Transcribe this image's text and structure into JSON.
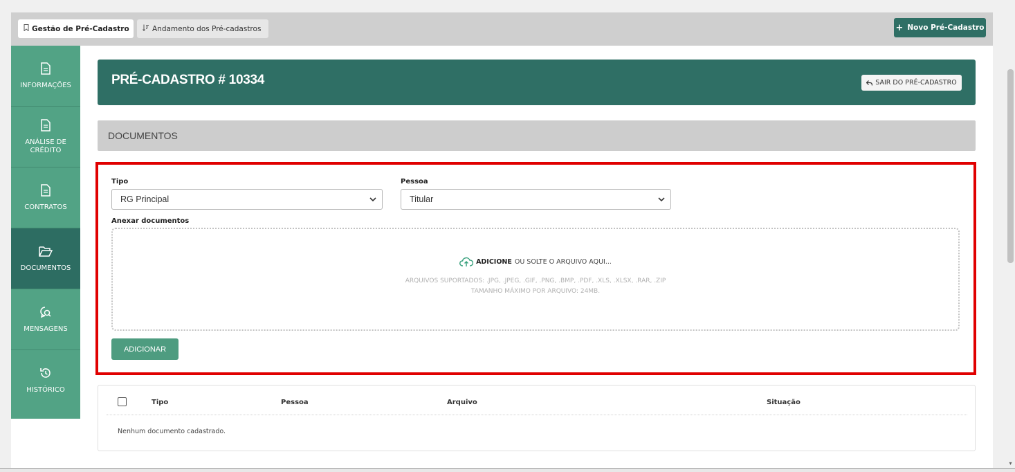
{
  "tabs": [
    {
      "label": "Gestão de Pré-Cadastro",
      "icon": "bookmark-icon",
      "active": true
    },
    {
      "label": "Andamento dos Pré-cadastros",
      "icon": "sort-icon",
      "active": false
    }
  ],
  "new_button": {
    "label": "Novo Pré-Cadastro",
    "icon": "plus-icon"
  },
  "sidebar": {
    "items": [
      {
        "label": "INFORMAÇÕES",
        "icon": "document-icon",
        "active": false
      },
      {
        "label": "ANÁLISE DE CRÉDITO",
        "icon": "document-icon",
        "active": false
      },
      {
        "label": "CONTRATOS",
        "icon": "document-icon",
        "active": false
      },
      {
        "label": "DOCUMENTOS",
        "icon": "folder-open-icon",
        "active": true
      },
      {
        "label": "MENSAGENS",
        "icon": "chat-search-icon",
        "active": false
      },
      {
        "label": "HISTÓRICO",
        "icon": "history-icon",
        "active": false
      }
    ]
  },
  "header": {
    "title": "PRÉ-CADASTRO # 10334",
    "exit_label": "SAIR DO PRÉ-CADASTRO"
  },
  "section": {
    "title": "DOCUMENTOS"
  },
  "form": {
    "tipo_label": "Tipo",
    "tipo_value": "RG Principal",
    "pessoa_label": "Pessoa",
    "pessoa_value": "Titular",
    "anexar_label": "Anexar documentos",
    "dropzone": {
      "action": "ADICIONE",
      "rest": "OU SOLTE O ARQUIVO AQUI...",
      "supported": "ARQUIVOS SUPORTADOS: .JPG, .JPEG, .GIF, .PNG, .BMP, .PDF, .XLS, .XLSX, .RAR, .ZIP",
      "max_size": "TAMANHO MÁXIMO POR ARQUIVO: 24MB."
    },
    "add_button": "ADICIONAR"
  },
  "table": {
    "columns": [
      "Tipo",
      "Pessoa",
      "Arquivo",
      "Situação"
    ],
    "empty_message": "Nenhum documento cadastrado."
  },
  "colors": {
    "primary_dark": "#2f6f65",
    "sidebar": "#52a385",
    "highlight_border": "#e00000"
  }
}
